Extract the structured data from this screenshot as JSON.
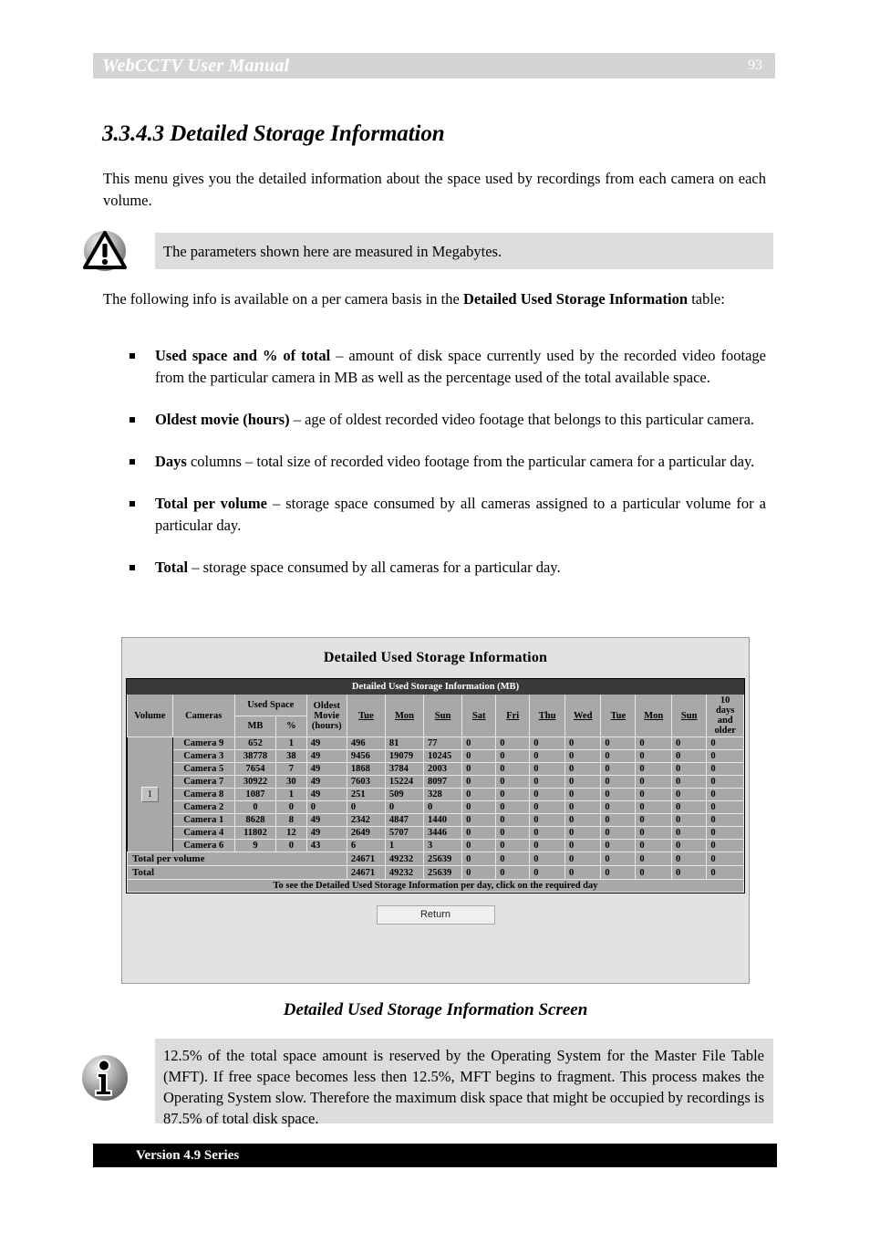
{
  "header": {
    "title": "WebCCTV User Manual",
    "page_number": "93"
  },
  "section": {
    "heading": "3.3.4.3 Detailed Storage Information"
  },
  "intro": {
    "paragraph": "This menu gives you the detailed information about the space used by recordings from each camera on each volume."
  },
  "note_megabytes": {
    "icon": "warning-triangle-icon",
    "text": "The parameters shown here are measured in Megabytes."
  },
  "following": {
    "prefix": "The following info is available on a per camera basis in the ",
    "bold": "Detailed Used Storage Information",
    "suffix": " table:"
  },
  "bullets": [
    {
      "term": "Used space and % of total",
      "text": " – amount of disk space currently used by the recorded video footage from the particular camera in MB as well as the percentage used of the total available space."
    },
    {
      "term": "Oldest movie (hours)",
      "text": " – age of oldest recorded video footage that belongs to this particular camera."
    },
    {
      "term": "Days",
      "text": " columns – total size of recorded video footage from the particular camera for a particular day."
    },
    {
      "term": "Total per volume",
      "text": " – storage space consumed by all cameras assigned to a particular volume for a particular day."
    },
    {
      "term": "Total",
      "text": " – storage space consumed by all cameras for a particular day."
    }
  ],
  "figure": {
    "title": "Detailed Used Storage Information",
    "table_caption": "Detailed Used Storage Information (MB)",
    "headers": {
      "volume": "Volume",
      "cameras": "Cameras",
      "used_space": "Used Space",
      "mb": "MB",
      "pct": "%",
      "oldest_movie": "Oldest Movie (hours)",
      "oldest_movie_l1": "Oldest",
      "oldest_movie_l2": "Movie",
      "oldest_movie_l3": "(hours)",
      "days": [
        "Tue",
        "Mon",
        "Sun",
        "Sat",
        "Fri",
        "Thu",
        "Wed",
        "Tue",
        "Mon",
        "Sun"
      ],
      "older": "10 days and older",
      "older_l1": "10",
      "older_l2": "days",
      "older_l3": "and",
      "older_l4": "older"
    },
    "volume_label": "1",
    "rows": [
      {
        "camera": "Camera 9",
        "mb": "652",
        "pct": "1",
        "oldest": "49",
        "days": [
          "496",
          "81",
          "77",
          "0",
          "0",
          "0",
          "0",
          "0",
          "0",
          "0"
        ],
        "older": "0"
      },
      {
        "camera": "Camera 3",
        "mb": "38778",
        "pct": "38",
        "oldest": "49",
        "days": [
          "9456",
          "19079",
          "10245",
          "0",
          "0",
          "0",
          "0",
          "0",
          "0",
          "0"
        ],
        "older": "0"
      },
      {
        "camera": "Camera 5",
        "mb": "7654",
        "pct": "7",
        "oldest": "49",
        "days": [
          "1868",
          "3784",
          "2003",
          "0",
          "0",
          "0",
          "0",
          "0",
          "0",
          "0"
        ],
        "older": "0"
      },
      {
        "camera": "Camera 7",
        "mb": "30922",
        "pct": "30",
        "oldest": "49",
        "days": [
          "7603",
          "15224",
          "8097",
          "0",
          "0",
          "0",
          "0",
          "0",
          "0",
          "0"
        ],
        "older": "0"
      },
      {
        "camera": "Camera 8",
        "mb": "1087",
        "pct": "1",
        "oldest": "49",
        "days": [
          "251",
          "509",
          "328",
          "0",
          "0",
          "0",
          "0",
          "0",
          "0",
          "0"
        ],
        "older": "0"
      },
      {
        "camera": "Camera 2",
        "mb": "0",
        "pct": "0",
        "oldest": "0",
        "days": [
          "0",
          "0",
          "0",
          "0",
          "0",
          "0",
          "0",
          "0",
          "0",
          "0"
        ],
        "older": "0"
      },
      {
        "camera": "Camera 1",
        "mb": "8628",
        "pct": "8",
        "oldest": "49",
        "days": [
          "2342",
          "4847",
          "1440",
          "0",
          "0",
          "0",
          "0",
          "0",
          "0",
          "0"
        ],
        "older": "0"
      },
      {
        "camera": "Camera 4",
        "mb": "11802",
        "pct": "12",
        "oldest": "49",
        "days": [
          "2649",
          "5707",
          "3446",
          "0",
          "0",
          "0",
          "0",
          "0",
          "0",
          "0"
        ],
        "older": "0"
      },
      {
        "camera": "Camera 6",
        "mb": "9",
        "pct": "0",
        "oldest": "43",
        "days": [
          "6",
          "1",
          "3",
          "0",
          "0",
          "0",
          "0",
          "0",
          "0",
          "0"
        ],
        "older": "0"
      }
    ],
    "total_per_volume": {
      "label": "Total per volume",
      "days": [
        "24671",
        "49232",
        "25639",
        "0",
        "0",
        "0",
        "0",
        "0",
        "0",
        "0"
      ],
      "older": "0"
    },
    "total": {
      "label": "Total",
      "days": [
        "24671",
        "49232",
        "25639",
        "0",
        "0",
        "0",
        "0",
        "0",
        "0",
        "0"
      ],
      "older": "0"
    },
    "footer_note": "To see the Detailed Used Storage Information per day, click on the required day",
    "return_button": "Return",
    "caption": "Detailed Used Storage Information Screen"
  },
  "note_mft": {
    "icon": "info-circle-icon",
    "text": "12.5% of the total space amount is reserved by the Operating System for the Master File Table (MFT). If free space becomes less then 12.5%, MFT begins to fragment. This process makes the Operating System slow. Therefore the maximum disk space that might be occupied by recordings is 87.5% of total disk space."
  },
  "footer": {
    "version": "Version 4.9 Series"
  }
}
